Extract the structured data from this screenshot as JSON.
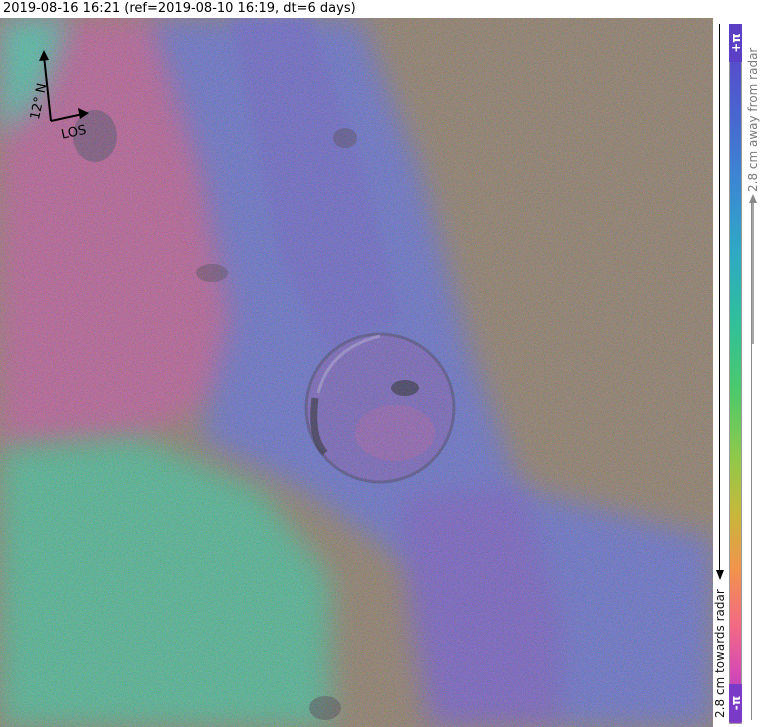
{
  "header": {
    "title": "2019-08-16 16:21 (ref=2019-08-10 16:19, dt=6 days)"
  },
  "map": {
    "subject": "volcano-crater-interferogram",
    "colors": {
      "plain_east": "#7d6a5a",
      "swath": "#5a62c8",
      "west_pink": "#b2508f",
      "southwest_green": "#3fae8c",
      "crater": "#8a55b4"
    }
  },
  "compass": {
    "north_label": "12° N",
    "los_label": "LOS"
  },
  "colorbar": {
    "top_label": "+π",
    "bottom_label": "-π",
    "away_label": "2.8 cm away from radar",
    "towards_label": "2.8 cm towards radar"
  }
}
